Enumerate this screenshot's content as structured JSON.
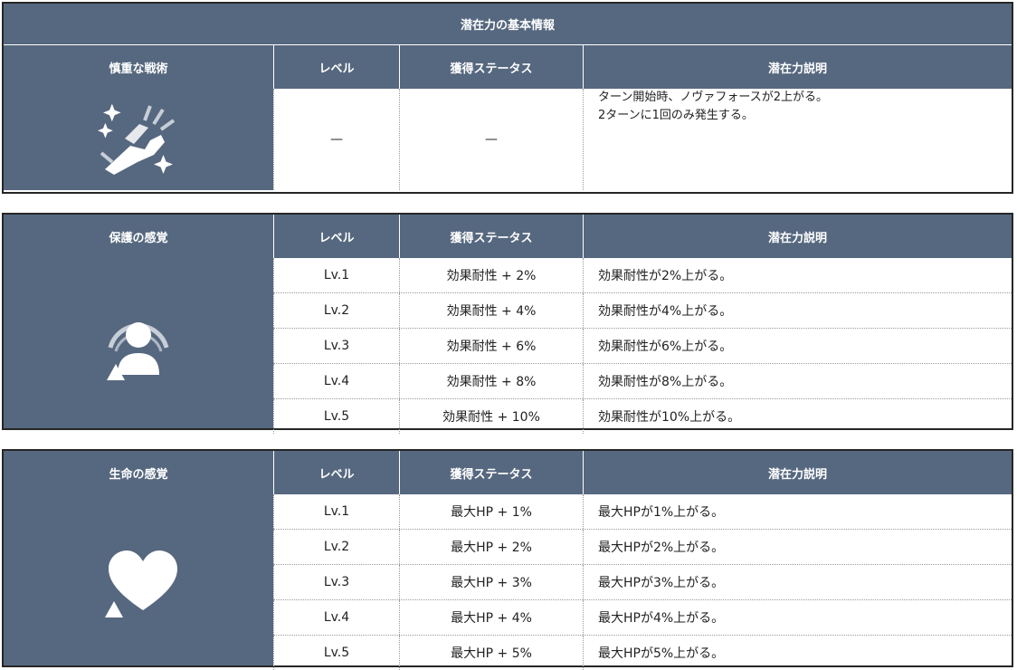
{
  "block1": {
    "title": "潜在力の基本情報",
    "headers": [
      "慎重な戦術",
      "レベル",
      "獲得ステータス",
      "潜在力説明"
    ],
    "icon": "hand-sparkle-icon",
    "row": {
      "level": "—",
      "status": "—",
      "desc_line1": "ターン開始時、ノヴァフォースが2上がる。",
      "desc_line2": "2ターンに1回のみ発生する。"
    }
  },
  "block2": {
    "headers": [
      "保護の感覚",
      "レベル",
      "獲得ステータス",
      "潜在力説明"
    ],
    "icon": "shielded-person-icon",
    "rows": [
      {
        "level": "Lv.1",
        "status": "効果耐性 + 2%",
        "desc": "効果耐性が2%上がる。"
      },
      {
        "level": "Lv.2",
        "status": "効果耐性 + 4%",
        "desc": "効果耐性が4%上がる。"
      },
      {
        "level": "Lv.3",
        "status": "効果耐性 + 6%",
        "desc": "効果耐性が6%上がる。"
      },
      {
        "level": "Lv.4",
        "status": "効果耐性 + 8%",
        "desc": "効果耐性が8%上がる。"
      },
      {
        "level": "Lv.5",
        "status": "効果耐性 + 10%",
        "desc": "効果耐性が10%上がる。"
      }
    ]
  },
  "block3": {
    "headers": [
      "生命の感覚",
      "レベル",
      "獲得ステータス",
      "潜在力説明"
    ],
    "icon": "heart-icon",
    "rows": [
      {
        "level": "Lv.1",
        "status": "最大HP + 1%",
        "desc": "最大HPが1%上がる。"
      },
      {
        "level": "Lv.2",
        "status": "最大HP + 2%",
        "desc": "最大HPが2%上がる。"
      },
      {
        "level": "Lv.3",
        "status": "最大HP + 3%",
        "desc": "最大HPが3%上がる。"
      },
      {
        "level": "Lv.4",
        "status": "最大HP + 4%",
        "desc": "最大HPが4%上がる。"
      },
      {
        "level": "Lv.5",
        "status": "最大HP + 5%",
        "desc": "最大HPが5%上がる。"
      }
    ]
  },
  "colors": {
    "header_bg": "#56687f",
    "border": "#262626"
  }
}
